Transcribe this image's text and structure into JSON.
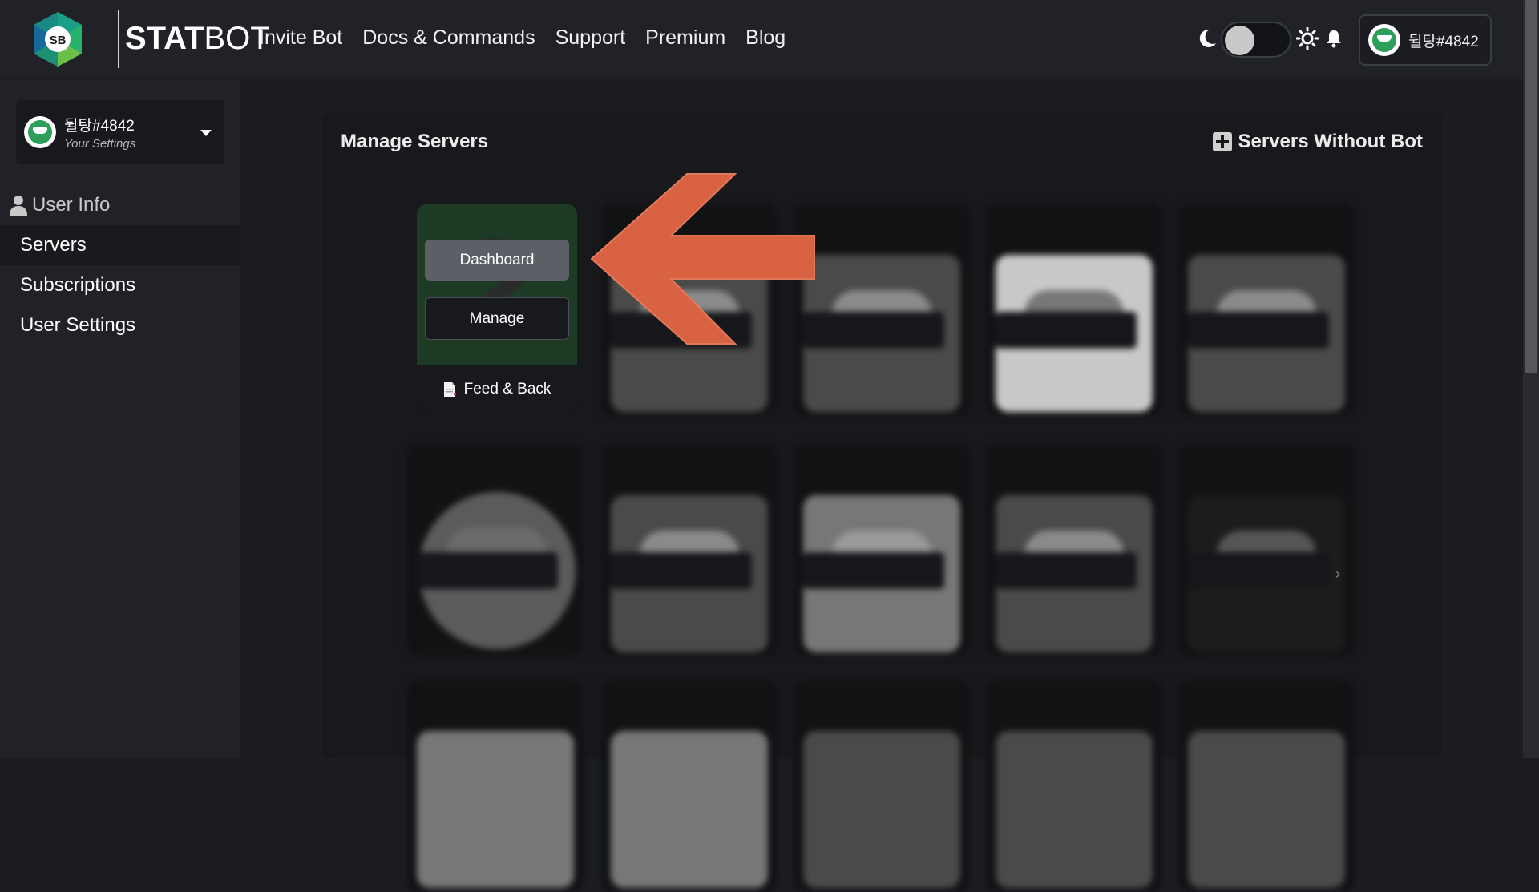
{
  "brand": {
    "logo_badge": "SB",
    "name_bold": "STAT",
    "name_light": "BOT"
  },
  "nav": {
    "links": [
      "Invite Bot",
      "Docs & Commands",
      "Support",
      "Premium",
      "Blog"
    ]
  },
  "theme": {
    "mode": "dark"
  },
  "user": {
    "name": "뒬탕#4842",
    "settings_label": "Your Settings"
  },
  "sidebar": {
    "section_label": "User Info",
    "items": [
      {
        "label": "Servers",
        "active": true
      },
      {
        "label": "Subscriptions",
        "active": false
      },
      {
        "label": "User Settings",
        "active": false
      }
    ]
  },
  "main": {
    "title": "Manage Servers",
    "servers_without_bot": "Servers Without Bot",
    "featured": {
      "dashboard_label": "Dashboard",
      "manage_label": "Manage",
      "name": "Feed & Back"
    }
  },
  "colors": {
    "accent_arrow": "#d96242",
    "featured_bg": "#1d3a25",
    "panel_bg": "#17191c"
  }
}
